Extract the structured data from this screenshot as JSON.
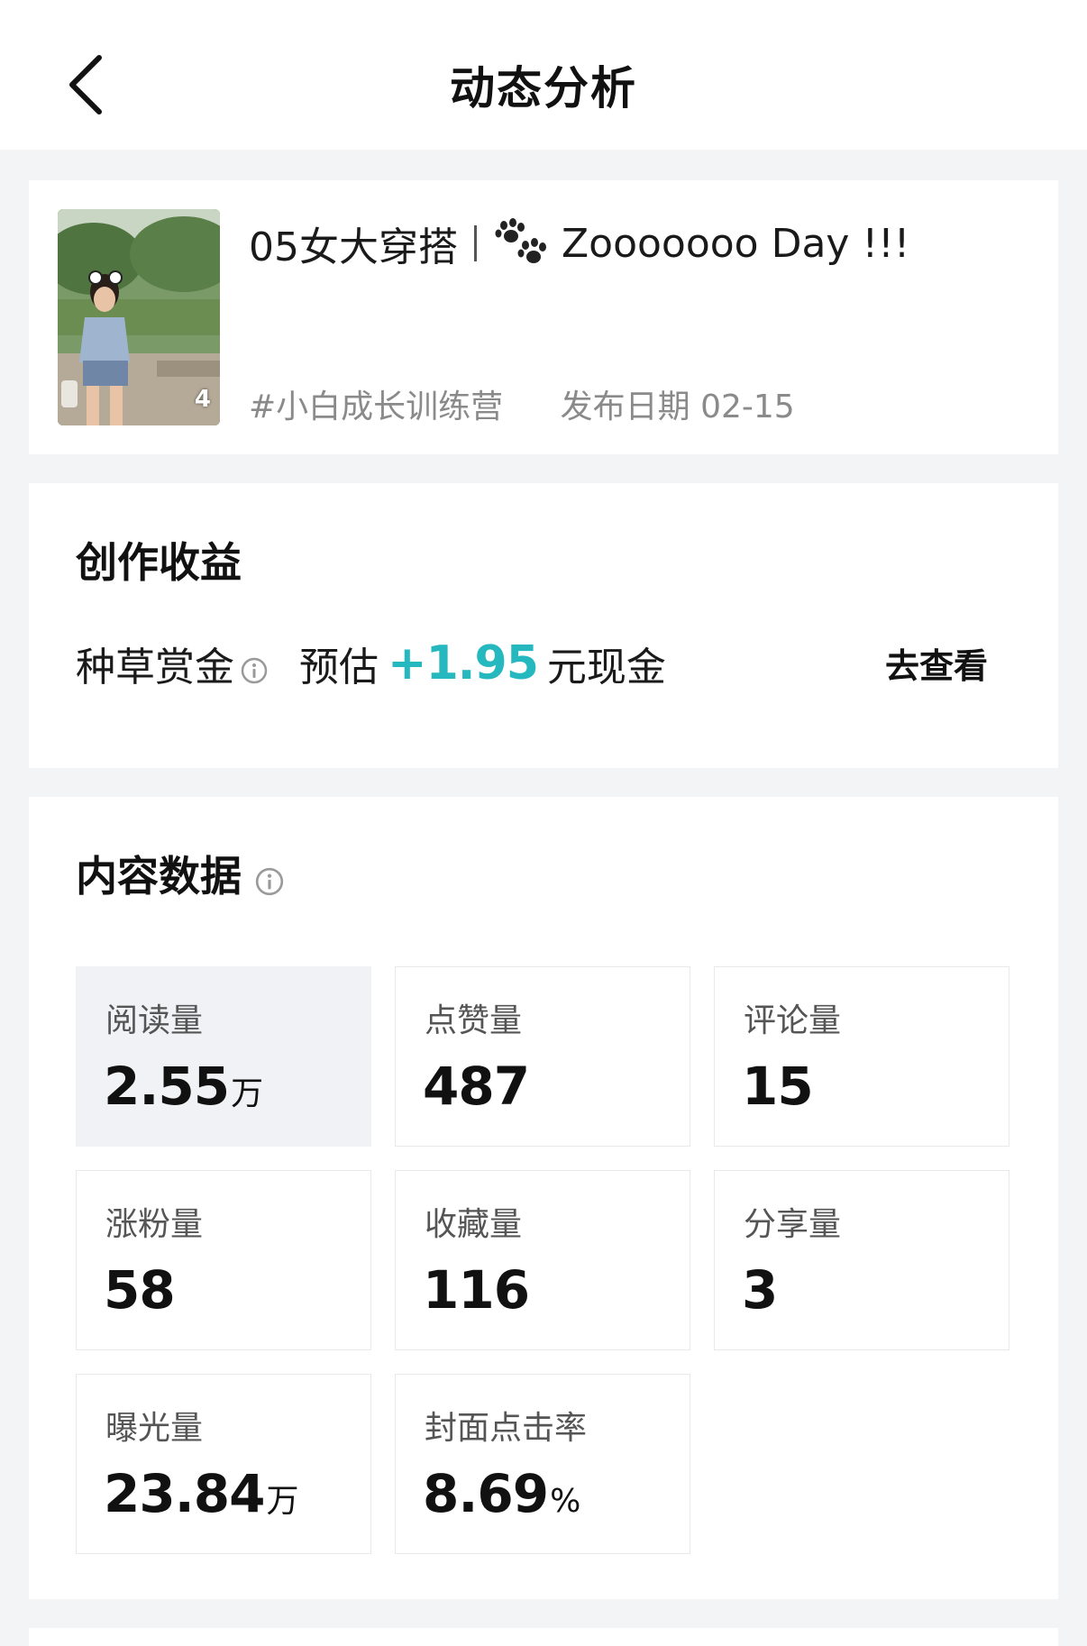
{
  "header": {
    "title": "动态分析"
  },
  "post": {
    "image_count": "4",
    "title_prefix": "05女大穿搭",
    "title_suffix": "Zooooooo Day !!!",
    "tag": "#小白成长训练营",
    "publish_date": "发布日期 02-15"
  },
  "earnings": {
    "title": "创作收益",
    "item_label": "种草赏金",
    "estimate_label": "预估",
    "estimate_value": "+1.95",
    "estimate_unit": "元现金",
    "view_link": "去查看"
  },
  "content_data": {
    "title": "内容数据",
    "metrics": [
      {
        "label": "阅读量",
        "value": "2.55",
        "unit": "万"
      },
      {
        "label": "点赞量",
        "value": "487",
        "unit": ""
      },
      {
        "label": "评论量",
        "value": "15",
        "unit": ""
      },
      {
        "label": "涨粉量",
        "value": "58",
        "unit": ""
      },
      {
        "label": "收藏量",
        "value": "116",
        "unit": ""
      },
      {
        "label": "分享量",
        "value": "3",
        "unit": ""
      },
      {
        "label": "曝光量",
        "value": "23.84",
        "unit": "万"
      },
      {
        "label": "封面点击率",
        "value": "8.69",
        "unit": "%"
      }
    ]
  },
  "colors": {
    "accent": "#25b8be",
    "background": "#f3f4f6",
    "active_tile": "#f1f2f5"
  },
  "icons": {
    "back": "chevron-left-icon",
    "paw": "paw-prints-icon",
    "info": "info-circle-icon"
  }
}
